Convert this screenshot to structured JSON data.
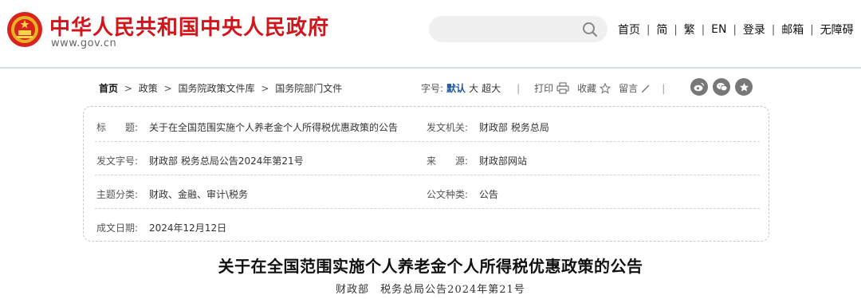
{
  "header": {
    "site_title": "中华人民共和国中央人民政府",
    "site_url": "www.gov.cn",
    "brand_color": "#d0161b",
    "search": {
      "placeholder": "",
      "value": ""
    },
    "nav": [
      "首页",
      "简",
      "繁",
      "EN",
      "登录",
      "邮箱",
      "无障碍"
    ]
  },
  "breadcrumb": {
    "items": [
      "首页",
      "政策",
      "国务院政策文件库",
      "国务院部门文件"
    ],
    "separator": ">"
  },
  "toolbar": {
    "font_size_label": "字号:",
    "font_sizes": [
      "默认",
      "大",
      "超大"
    ],
    "active_font_size": "默认",
    "print_label": "打印",
    "favorite_label": "收藏",
    "comment_label": "留言",
    "share_icons": [
      "weibo-icon",
      "wechat-icon",
      "star-icon"
    ]
  },
  "info": {
    "rows": [
      [
        {
          "key": "标　　题:",
          "value": "关于在全国范围实施个人养老金个人所得税优惠政策的公告"
        },
        {
          "key": "发文机关:",
          "value": "财政部 税务总局"
        }
      ],
      [
        {
          "key": "发文字号:",
          "value": "财政部 税务总局公告2024年第21号"
        },
        {
          "key": "来　　源:",
          "value": "财政部网站"
        }
      ],
      [
        {
          "key": "主题分类:",
          "value": "财政、金融、审计\\税务"
        },
        {
          "key": "公文种类:",
          "value": "公告"
        }
      ],
      [
        {
          "key": "成文日期:",
          "value": "2024年12月12日"
        }
      ]
    ]
  },
  "article": {
    "title": "关于在全国范围实施个人养老金个人所得税优惠政策的公告",
    "doc_number": "财政部　税务总局公告2024年第21号"
  }
}
